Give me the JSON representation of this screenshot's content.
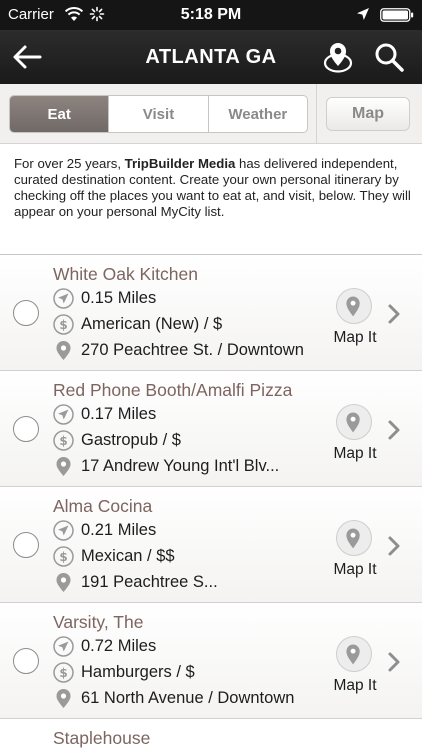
{
  "status_bar": {
    "carrier": "Carrier",
    "time": "5:18 PM"
  },
  "nav": {
    "title": "ATLANTA GA"
  },
  "segments": {
    "tabs": [
      {
        "label": "Eat",
        "active": true
      },
      {
        "label": "Visit",
        "active": false
      },
      {
        "label": "Weather",
        "active": false
      }
    ],
    "map_label": "Map"
  },
  "intro": {
    "prefix": "For over 25 years, ",
    "brand": "TripBuilder Media",
    "suffix": " has delivered independent, curated destination content. Create your own personal itinerary by checking off the places you want to eat at, and visit, below. They will appear on your personal MyCity list."
  },
  "map_it_label": "Map It",
  "places": [
    {
      "name": "White Oak Kitchen",
      "distance": "0.15 Miles",
      "category": "American (New) / $",
      "address": "270 Peachtree St. / Downtown"
    },
    {
      "name": "Red Phone Booth/Amalfi Pizza",
      "distance": "0.17 Miles",
      "category": "Gastropub / $",
      "address": "17 Andrew Young Int'l Blv..."
    },
    {
      "name": "Alma Cocina",
      "distance": "0.21 Miles",
      "category": "Mexican / $$",
      "address": "191 Peachtree S..."
    },
    {
      "name": "Varsity, The",
      "distance": "0.72 Miles",
      "category": "Hamburgers / $",
      "address": "61 North Avenue / Downtown"
    },
    {
      "name": "Staplehouse"
    }
  ],
  "icons": {
    "distance": "navigation-arrow-icon",
    "price": "dollar-icon",
    "address": "location-pin-icon",
    "map_it": "map-pin-icon",
    "row_disclosure": "chevron-right-icon"
  },
  "colors": {
    "place_name": "#7d6560",
    "active_segment": "#7d7470",
    "nav_bar": "#222222"
  }
}
